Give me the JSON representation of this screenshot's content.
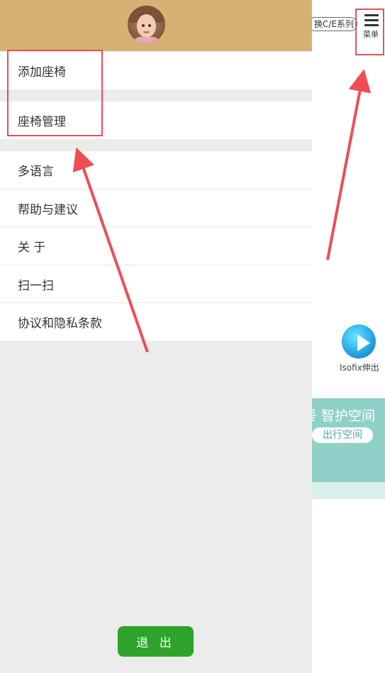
{
  "background_app": {
    "switch_label": "换C/E系列",
    "menu_label": "菜单",
    "isofix_label": "Isofix伸出",
    "banner_title": "号 智护空间",
    "banner_button": "出行空间"
  },
  "drawer": {
    "menu_items": [
      {
        "label": "添加座椅"
      },
      {
        "label": "座椅管理"
      },
      {
        "label": "多语言"
      },
      {
        "label": "帮助与建议"
      },
      {
        "label": "关 于"
      },
      {
        "label": "扫一扫"
      },
      {
        "label": "协议和隐私条款"
      }
    ],
    "logout_label": "退 出"
  },
  "colors": {
    "header": "#d4b273",
    "logout": "#2ea32a",
    "annotation": "#ee4d55",
    "drawer_bg": "#ececec"
  }
}
